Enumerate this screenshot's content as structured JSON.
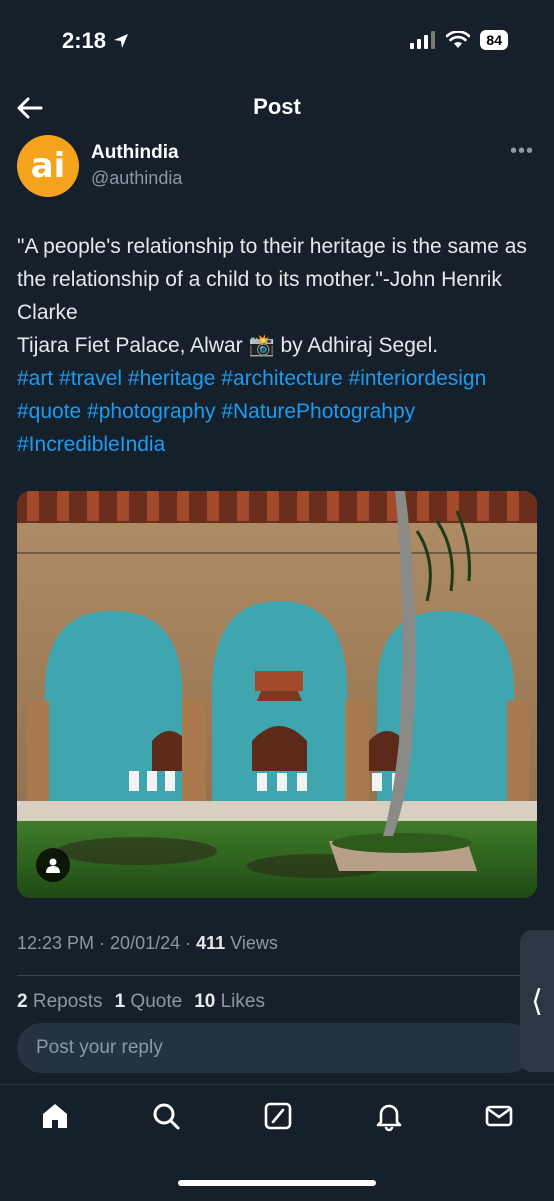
{
  "status_bar": {
    "time": "2:18",
    "battery": "84"
  },
  "header": {
    "title": "Post"
  },
  "author": {
    "avatar_text": "ai",
    "name": "Authindia",
    "handle": "@authindia"
  },
  "tweet": {
    "quote": "\"A people's relationship to their heritage is the same as the relationship of a child to its mother.\"-John Henrik Clarke",
    "caption_prefix": "Tijara Fiet Palace, Alwar ",
    "caption_emoji": "📸",
    "caption_suffix": " by Adhiraj Segel.",
    "hashtags": "#art #travel #heritage #architecture #interiordesign #quote #photography #NaturePhotograhpy #IncredibleIndia"
  },
  "meta": {
    "time": "12:23 PM",
    "date": "20/01/24",
    "views_count": "411",
    "views_label": "Views"
  },
  "stats": {
    "reposts_count": "2",
    "reposts_label": "Reposts",
    "quotes_count": "1",
    "quotes_label": "Quote",
    "likes_count": "10",
    "likes_label": "Likes"
  },
  "reply": {
    "placeholder": "Post your reply"
  },
  "side_handle": {
    "glyph": "⟨"
  },
  "nav": {
    "items": [
      "home-icon",
      "search-icon",
      "grok-icon",
      "notifications-icon",
      "messages-icon"
    ]
  },
  "colors": {
    "background": "#15202b",
    "link": "#1d9bf0",
    "muted": "#8b98a5",
    "avatar": "#f5a21c"
  }
}
